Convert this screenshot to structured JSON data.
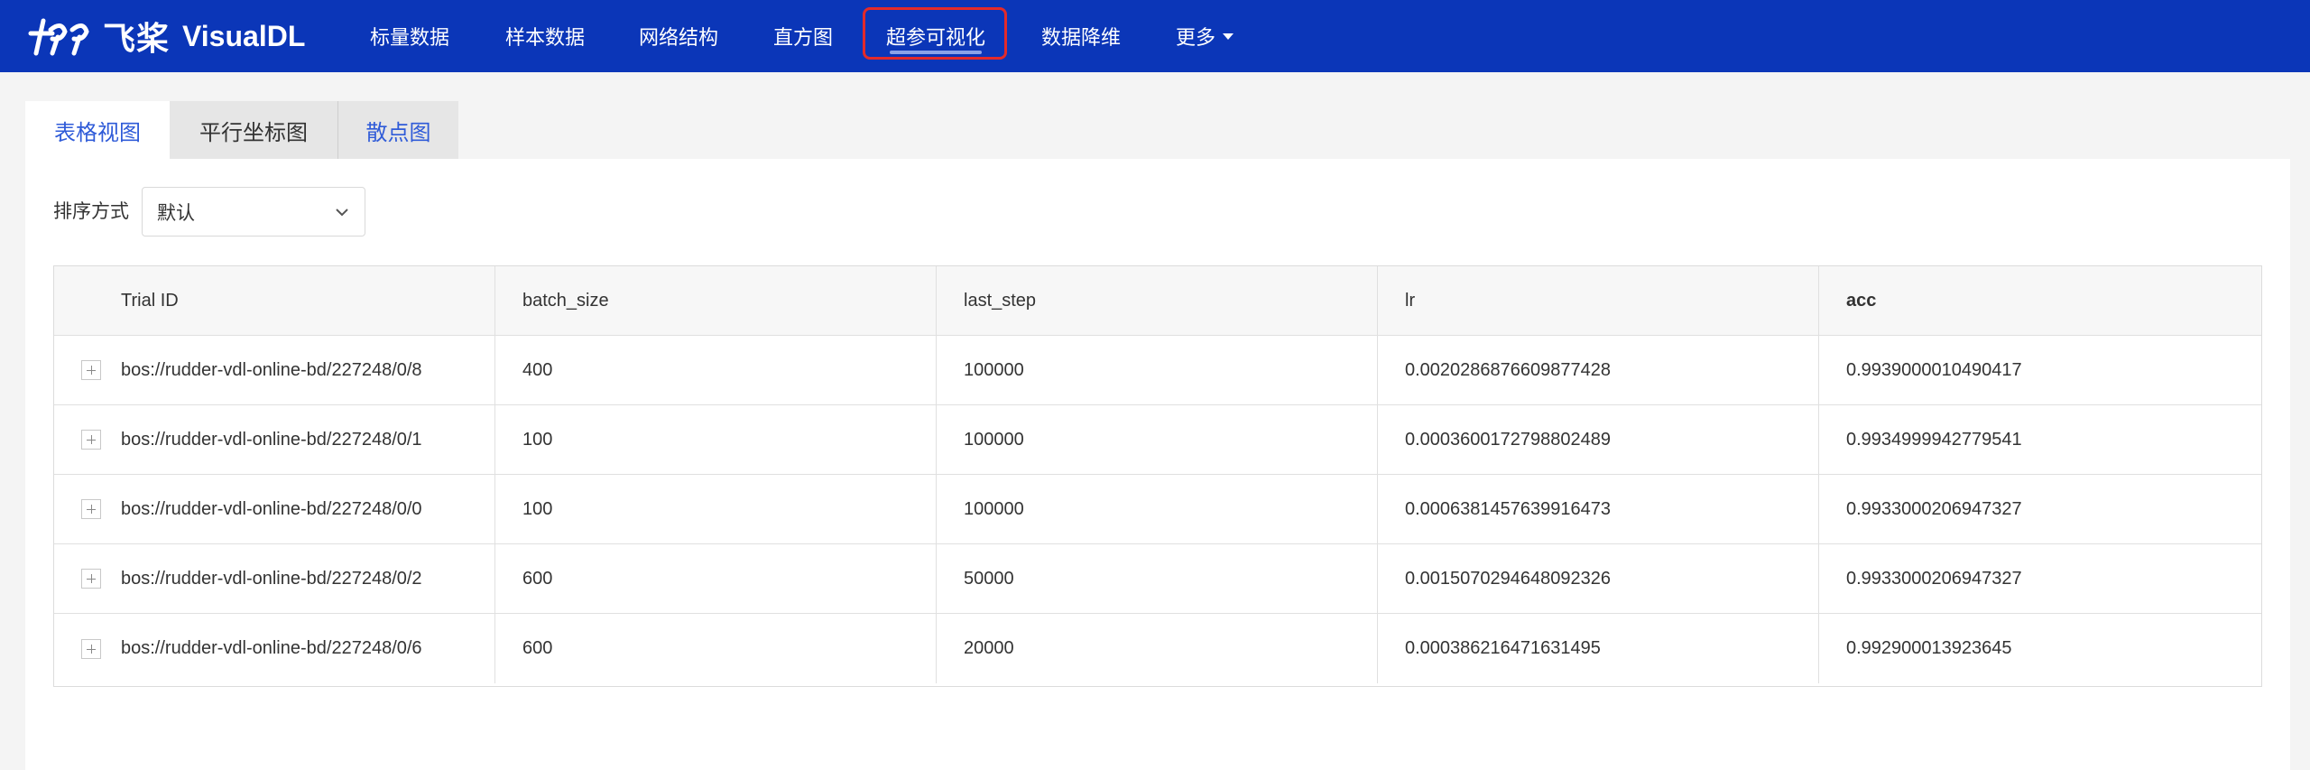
{
  "brand": {
    "name_cn": "飞桨",
    "name_en": "VisualDL"
  },
  "nav": {
    "items": [
      {
        "label": "标量数据"
      },
      {
        "label": "样本数据"
      },
      {
        "label": "网络结构"
      },
      {
        "label": "直方图"
      },
      {
        "label": "超参可视化",
        "active": true
      },
      {
        "label": "数据降维"
      },
      {
        "label": "更多"
      }
    ]
  },
  "tabs": [
    {
      "label": "表格视图",
      "active": true
    },
    {
      "label": "平行坐标图"
    },
    {
      "label": "散点图"
    }
  ],
  "sort": {
    "label": "排序方式",
    "value": "默认"
  },
  "table": {
    "headers": [
      "Trial ID",
      "batch_size",
      "last_step",
      "lr",
      "acc"
    ],
    "rows": [
      [
        "bos://rudder-vdl-online-bd/227248/0/8",
        "400",
        "100000",
        "0.0020286876609877428",
        "0.9939000010490417"
      ],
      [
        "bos://rudder-vdl-online-bd/227248/0/1",
        "100",
        "100000",
        "0.0003600172798802489",
        "0.9934999942779541"
      ],
      [
        "bos://rudder-vdl-online-bd/227248/0/0",
        "100",
        "100000",
        "0.0006381457639916473",
        "0.9933000206947327"
      ],
      [
        "bos://rudder-vdl-online-bd/227248/0/2",
        "600",
        "50000",
        "0.0015070294648092326",
        "0.9933000206947327"
      ],
      [
        "bos://rudder-vdl-online-bd/227248/0/6",
        "600",
        "20000",
        "0.000386216471631495",
        "0.992900013923645"
      ]
    ]
  },
  "colors": {
    "nav_bg": "#0b36b8",
    "accent": "#2f5bd8",
    "highlight": "#e32a2a"
  }
}
